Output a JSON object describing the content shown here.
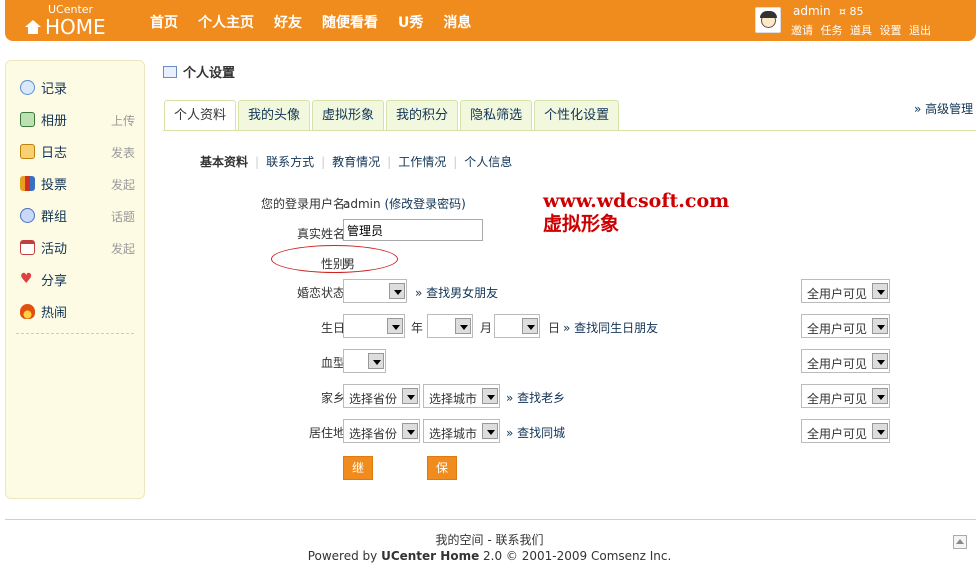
{
  "header": {
    "logo_top": "UCenter",
    "logo_main": "HOME",
    "nav": [
      "首页",
      "个人主页",
      "好友",
      "随便看看",
      "U秀",
      "消息"
    ],
    "user": {
      "name": "admin",
      "credit": "85",
      "links": [
        "邀请",
        "任务",
        "道具",
        "设置",
        "退出"
      ]
    }
  },
  "sidebar": {
    "items": [
      {
        "label": "记录",
        "sub": "",
        "icon": "speech-bubble-icon",
        "color": "#5a8fd0"
      },
      {
        "label": "相册",
        "sub": "上传",
        "icon": "photo-icon",
        "color": "#3a7a3a"
      },
      {
        "label": "日志",
        "sub": "发表",
        "icon": "notebook-icon",
        "color": "#e8a020"
      },
      {
        "label": "投票",
        "sub": "发起",
        "icon": "bar-chart-icon",
        "color": "#d03020"
      },
      {
        "label": "群组",
        "sub": "话题",
        "icon": "group-icon",
        "color": "#4a70c0"
      },
      {
        "label": "活动",
        "sub": "发起",
        "icon": "calendar-icon",
        "color": "#c04040"
      },
      {
        "label": "分享",
        "sub": "",
        "icon": "heart-icon",
        "color": "#e04040"
      },
      {
        "label": "热闹",
        "sub": "",
        "icon": "fire-icon",
        "color": "#e05010"
      }
    ]
  },
  "page": {
    "title": "个人设置",
    "tabs": [
      "个人资料",
      "我的头像",
      "虚拟形象",
      "我的积分",
      "隐私筛选",
      "个性化设置"
    ],
    "advanced": "» 高级管理",
    "subnav": [
      "基本资料",
      "联系方式",
      "教育情况",
      "工作情况",
      "个人信息"
    ]
  },
  "form": {
    "username_label": "您的登录用户名:",
    "username_value": "admin",
    "username_link": "(修改登录密码)",
    "realname_label": "真实姓名:",
    "realname_value": "管理员",
    "gender_label": "性别:",
    "gender_value": "男",
    "marital_label": "婚恋状态:",
    "marital_link": "» 查找男女朋友",
    "birthday_label": "生日:",
    "birthday_year": "年",
    "birthday_month": "月",
    "birthday_day": "日",
    "birthday_link": "» 查找同生日朋友",
    "blood_label": "血型:",
    "hometown_label": "家乡:",
    "province_placeholder": "选择省份",
    "city_placeholder": "选择城市",
    "hometown_link": "» 查找老乡",
    "residence_label": "居住地:",
    "residence_link": "» 查找同城",
    "privacy_option": "全用户可见",
    "continue_button": "继续下一项",
    "save_button": "保存"
  },
  "watermark": {
    "line1": "www.wdcsoft.com",
    "line2": "虚拟形象"
  },
  "footer": {
    "line1": "我的空间 - 联系我们",
    "powered_prefix": "Powered by ",
    "product": "UCenter Home",
    "powered_suffix": " 2.0 © 2001-2009 Comsenz Inc."
  }
}
